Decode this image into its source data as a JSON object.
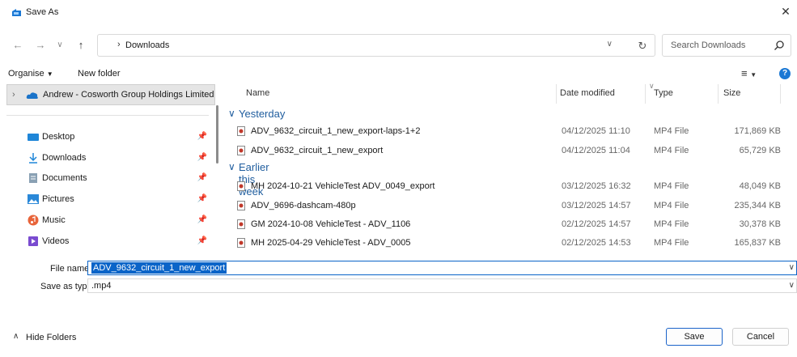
{
  "window": {
    "title": "Save As"
  },
  "nav": {
    "address_path": "Downloads",
    "search_placeholder": "Search Downloads"
  },
  "toolbar": {
    "organise_label": "Organise",
    "new_folder_label": "New folder"
  },
  "sidebar": {
    "top_item": "Andrew - Cosworth Group Holdings Limited",
    "items": [
      {
        "label": "Desktop",
        "icon": "desktop-icon",
        "color": "#1f86d8"
      },
      {
        "label": "Downloads",
        "icon": "download-icon",
        "color": "#1f86d8"
      },
      {
        "label": "Documents",
        "icon": "document-icon",
        "color": "#8aa1b4"
      },
      {
        "label": "Pictures",
        "icon": "pictures-icon",
        "color": "#2a88d8"
      },
      {
        "label": "Music",
        "icon": "music-icon",
        "color": "#e8643a"
      },
      {
        "label": "Videos",
        "icon": "videos-icon",
        "color": "#7a4bd0"
      }
    ]
  },
  "columns": {
    "name": "Name",
    "date_modified": "Date modified",
    "type": "Type",
    "size": "Size"
  },
  "groups": [
    {
      "label": "Yesterday",
      "files": [
        {
          "name": "ADV_9632_circuit_1_new_export-laps-1+2",
          "date": "04/12/2025 11:10",
          "type": "MP4 File",
          "size": "171,869 KB"
        },
        {
          "name": "ADV_9632_circuit_1_new_export",
          "date": "04/12/2025 11:04",
          "type": "MP4 File",
          "size": "65,729 KB"
        }
      ]
    },
    {
      "label": "Earlier this week",
      "files": [
        {
          "name": "MH 2024-10-21 VehicleTest ADV_0049_export",
          "date": "03/12/2025 16:32",
          "type": "MP4 File",
          "size": "48,049 KB"
        },
        {
          "name": "ADV_9696-dashcam-480p",
          "date": "03/12/2025 14:57",
          "type": "MP4 File",
          "size": "235,344 KB"
        },
        {
          "name": "GM 2024-10-08 VehicleTest - ADV_1106",
          "date": "02/12/2025 14:57",
          "type": "MP4 File",
          "size": "30,378 KB"
        },
        {
          "name": "MH 2025-04-29 VehicleTest - ADV_0005",
          "date": "02/12/2025 14:53",
          "type": "MP4 File",
          "size": "165,837 KB"
        }
      ]
    }
  ],
  "form": {
    "file_name_label": "File name:",
    "file_name_value": "ADV_9632_circuit_1_new_export",
    "save_type_label": "Save as type:",
    "save_type_value": ".mp4"
  },
  "footer": {
    "hide_folders_label": "Hide Folders",
    "save_label": "Save",
    "cancel_label": "Cancel"
  },
  "colors": {
    "accent": "#0a64c8",
    "group_text": "#1f5d9e",
    "selected_bg": "#e5e5e5"
  }
}
